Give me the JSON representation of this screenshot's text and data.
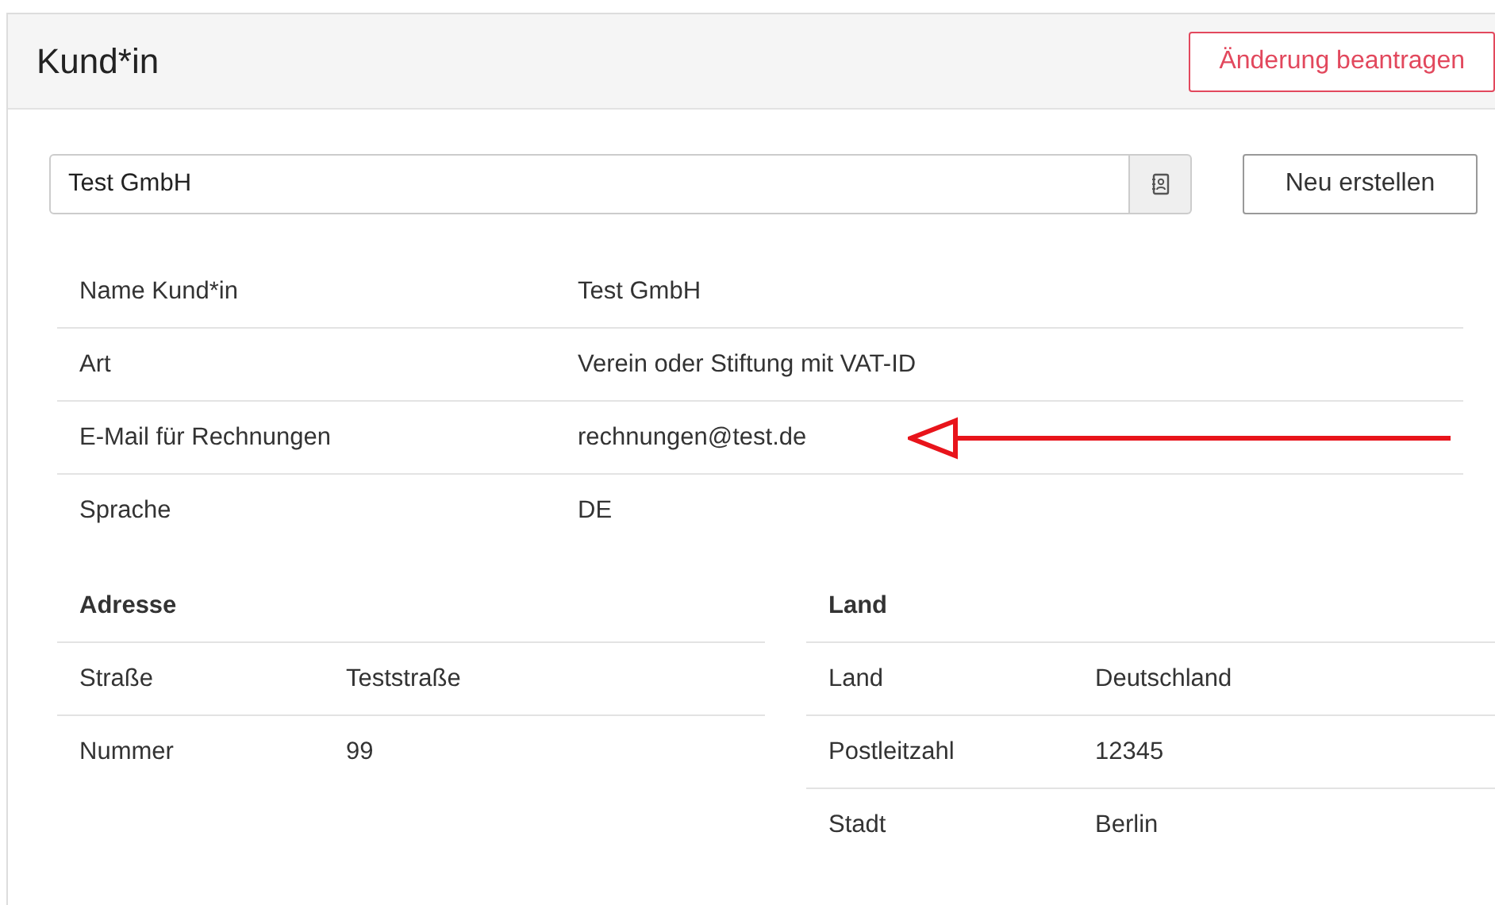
{
  "header": {
    "title": "Kund*in",
    "action_button": "Änderung beantragen"
  },
  "customer_field": {
    "value": "Test GmbH"
  },
  "create_button": "Neu erstellen",
  "details": [
    {
      "label": "Name Kund*in",
      "value": "Test GmbH",
      "highlighted": false
    },
    {
      "label": "Art",
      "value": "Verein oder Stiftung mit VAT-ID",
      "highlighted": false
    },
    {
      "label": "E-Mail für Rechnungen",
      "value": "rechnungen@test.de",
      "highlighted": true
    },
    {
      "label": "Sprache",
      "value": "DE",
      "highlighted": false
    }
  ],
  "address": {
    "title": "Adresse",
    "rows": [
      {
        "label": "Straße",
        "value": "Teststraße"
      },
      {
        "label": "Nummer",
        "value": "99"
      }
    ]
  },
  "country": {
    "title": "Land",
    "rows": [
      {
        "label": "Land",
        "value": "Deutschland"
      },
      {
        "label": "Postleitzahl",
        "value": "12345"
      },
      {
        "label": "Stadt",
        "value": "Berlin"
      }
    ]
  }
}
